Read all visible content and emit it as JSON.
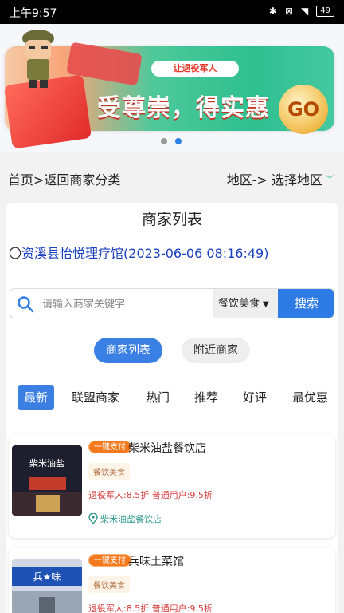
{
  "status": {
    "time": "上午9:57",
    "battery": "49"
  },
  "banner": {
    "tag": "让退役军人",
    "slogan": "受尊崇，得实惠",
    "go": "GO"
  },
  "nav": {
    "breadcrumb": "首页>返回商家分类",
    "region": "地区-> 选择地区"
  },
  "panel": {
    "title": "商家列表",
    "notice_prefix": "〇",
    "notice_link": "资溪县怡悦理疗馆(2023-06-06 08:16:49)"
  },
  "search": {
    "placeholder": "请输入商家关键字",
    "category": "餐饮美食",
    "button": "搜索"
  },
  "segments": {
    "list": "商家列表",
    "nearby": "附近商家"
  },
  "tabs": [
    "最新",
    "联盟商家",
    "热门",
    "推荐",
    "好评",
    "最优惠"
  ],
  "merchants": [
    {
      "pay": "一键支付",
      "name": "柴米油盐餐饮店",
      "category": "餐饮美食",
      "discount": "退役军人:8.5折 普通用户:9.5折",
      "location": "柴米油盐餐饮店",
      "sign": "柴米油盐"
    },
    {
      "pay": "一键支付",
      "name": "兵味土菜馆",
      "category": "餐饮美食",
      "discount": "退役军人:8.5折 普通用户:9.5折",
      "location": "",
      "sign": "兵★味"
    }
  ],
  "colors": {
    "accent": "#2e7be6",
    "discount": "#d63c3c",
    "location": "#2f9b8d",
    "pay": "#f47a1f"
  }
}
